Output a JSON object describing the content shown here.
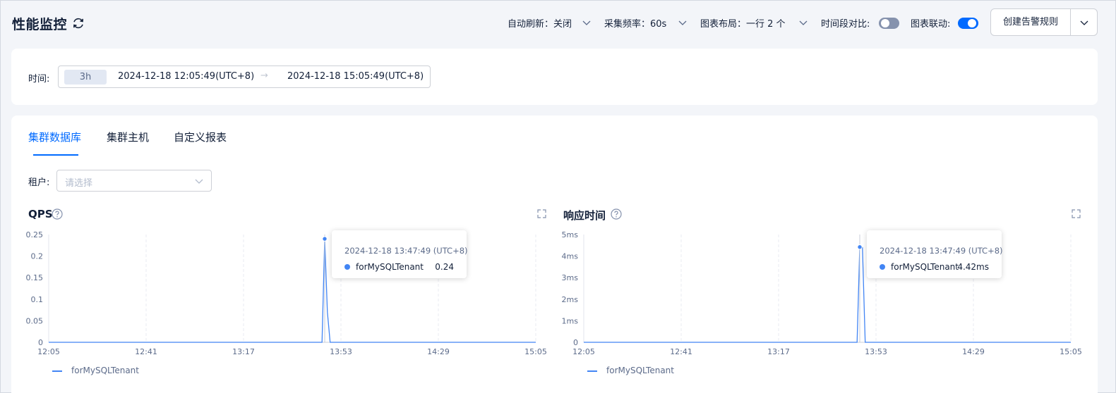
{
  "header": {
    "title": "性能监控",
    "auto_refresh": "自动刷新：关闭",
    "sample_rate": "采集频率：60s",
    "layout": "图表布局：一行 2 个",
    "compare_label": "时间段对比:",
    "compare_on": false,
    "linkage_label": "图表联动:",
    "linkage_on": true,
    "create_alert": "创建告警规则"
  },
  "time": {
    "label": "时间:",
    "tag": "3h",
    "start": "2024-12-18 12:05:49(UTC+8)",
    "arrow": "→",
    "end": "2024-12-18 15:05:49(UTC+8)"
  },
  "tabs": [
    {
      "label": "集群数据库",
      "active": true
    },
    {
      "label": "集群主机",
      "active": false
    },
    {
      "label": "自定义报表",
      "active": false
    }
  ],
  "tenant": {
    "label": "租户:",
    "placeholder": "请选择"
  },
  "charts": {
    "qps": {
      "title": "QPS",
      "legend": "forMySQLTenant",
      "tooltip": {
        "time": "2024-12-18 13:47:49 (UTC+8)",
        "name": "forMySQLTenant",
        "value": "0.24"
      }
    },
    "rt": {
      "title": "响应时间",
      "legend": "forMySQLTenant",
      "tooltip": {
        "time": "2024-12-18 13:47:49 (UTC+8)",
        "name": "forMySQLTenant",
        "value": "4.42ms"
      }
    }
  },
  "colors": {
    "accent": "#006aff",
    "series": "#4285f4"
  },
  "chart_data": [
    {
      "type": "line",
      "title": "QPS",
      "x_ticks": [
        "12:05",
        "12:41",
        "13:17",
        "13:53",
        "14:29",
        "15:05"
      ],
      "x_range": [
        "12:05",
        "15:05"
      ],
      "y_ticks": [
        "0",
        "0.05",
        "0.1",
        "0.15",
        "0.2",
        "0.25"
      ],
      "ylim": [
        0,
        0.25
      ],
      "grid": "vertical-dashed",
      "legend": "bottom-left",
      "series": [
        {
          "name": "forMySQLTenant",
          "points": [
            [
              "12:05",
              0
            ],
            [
              "13:46",
              0
            ],
            [
              "13:47",
              0.24
            ],
            [
              "13:48",
              0.07
            ],
            [
              "13:49",
              0
            ],
            [
              "15:05",
              0
            ]
          ]
        }
      ]
    },
    {
      "type": "line",
      "title": "响应时间",
      "x_ticks": [
        "12:05",
        "12:41",
        "13:17",
        "13:53",
        "14:29",
        "15:05"
      ],
      "x_range": [
        "12:05",
        "15:05"
      ],
      "y_ticks": [
        "0",
        "1ms",
        "2ms",
        "3ms",
        "4ms",
        "5ms"
      ],
      "ylim": [
        0,
        5
      ],
      "grid": "vertical-dashed",
      "legend": "bottom-left",
      "series": [
        {
          "name": "forMySQLTenant",
          "points": [
            [
              "12:05",
              0
            ],
            [
              "13:46",
              0
            ],
            [
              "13:47",
              4.42
            ],
            [
              "13:48",
              4.4
            ],
            [
              "13:49",
              0
            ],
            [
              "15:05",
              0
            ]
          ]
        }
      ]
    }
  ]
}
